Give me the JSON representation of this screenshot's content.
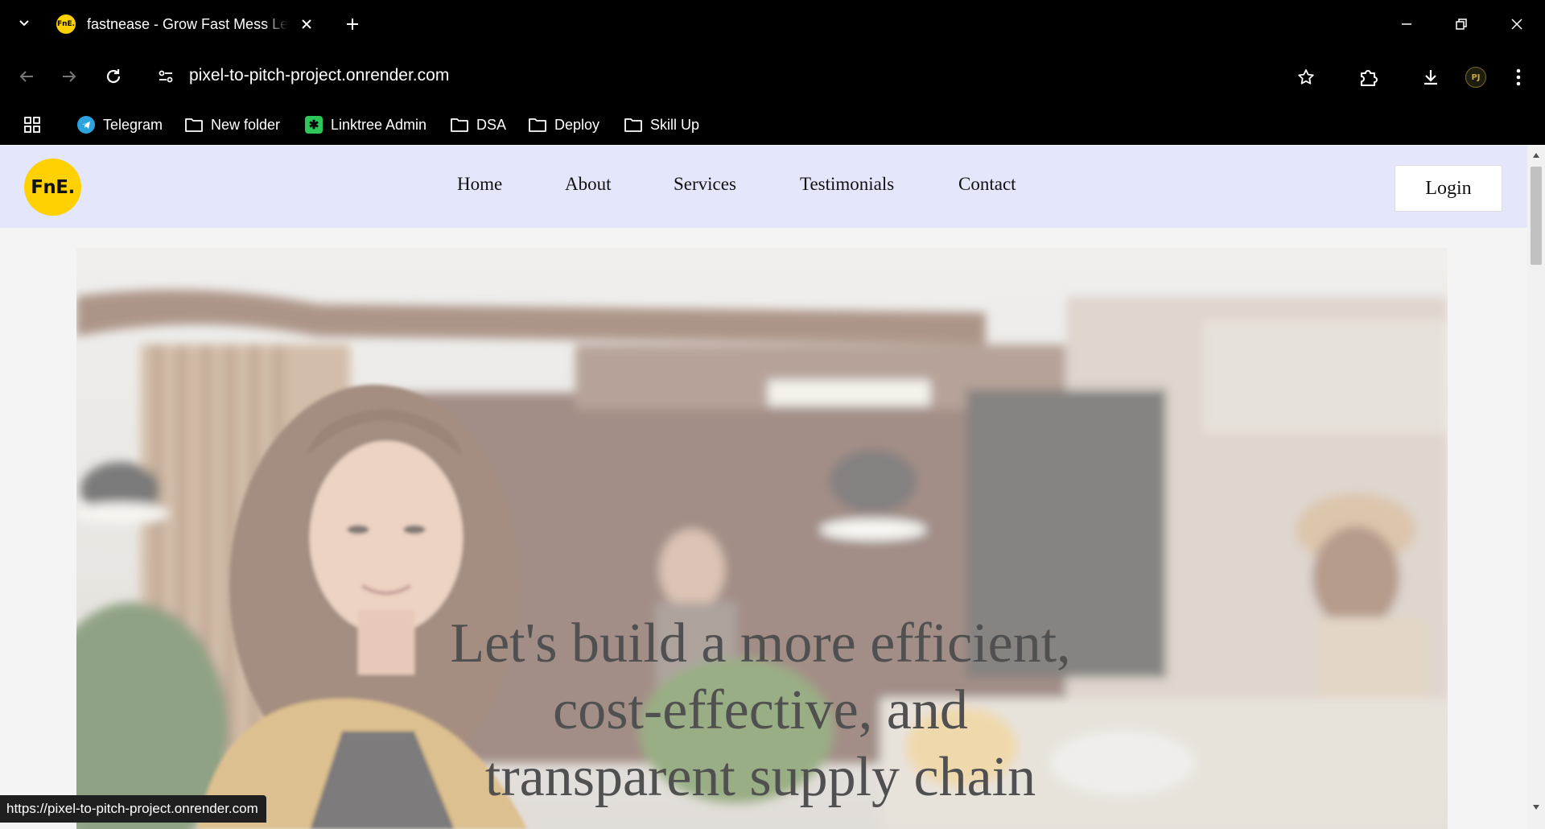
{
  "browser": {
    "tab": {
      "favicon_text": "FnE.",
      "title": "fastnease - Grow Fast Mess Less"
    },
    "address_bar": {
      "url": "pixel-to-pitch-project.onrender.com"
    },
    "profile_initials": "PJ",
    "bookmarks": [
      {
        "label": "Telegram",
        "icon": "telegram-icon"
      },
      {
        "label": "New folder",
        "icon": "folder-icon"
      },
      {
        "label": "Linktree Admin",
        "icon": "linktree-icon"
      },
      {
        "label": "DSA",
        "icon": "folder-icon"
      },
      {
        "label": "Deploy",
        "icon": "folder-icon"
      },
      {
        "label": "Skill Up",
        "icon": "folder-icon"
      }
    ],
    "status_url": "https://pixel-to-pitch-project.onrender.com"
  },
  "site": {
    "logo_text": "FnE.",
    "brand_color": "#ffd100",
    "header_bg": "#e4e6fb",
    "nav": [
      "Home",
      "About",
      "Services",
      "Testimonials",
      "Contact"
    ],
    "login_label": "Login",
    "hero": {
      "heading_lines": [
        "Let's build a more efficient,",
        "cost-effective, and",
        "transparent supply chain"
      ]
    }
  }
}
